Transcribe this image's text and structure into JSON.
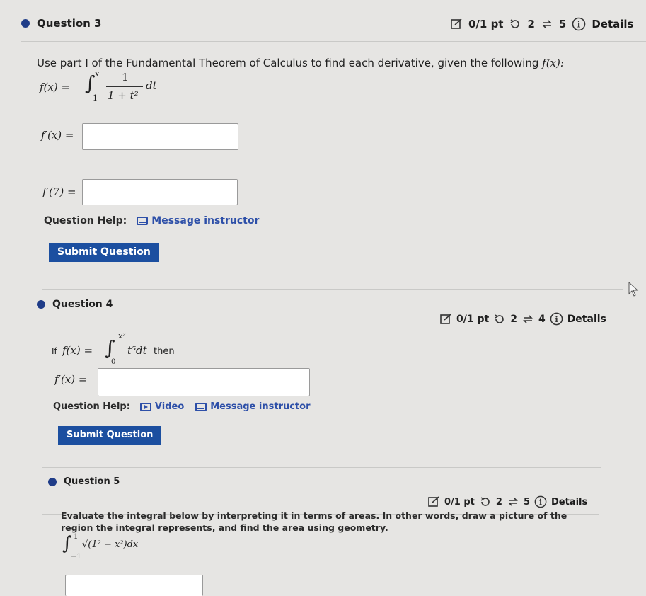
{
  "q3": {
    "title": "Question 3",
    "points": "0/1 pt",
    "tries": "2",
    "attempts": "5",
    "details": "Details",
    "prompt": "Use part I of the Fundamental Theorem of Calculus to find each derivative, given the following",
    "prompt_fx": "f(x):",
    "fx_label": "f(x) =",
    "integral_upper": "x",
    "integral_lower": "1",
    "integrand_num": "1",
    "integrand_den": "1 + t²",
    "integrand_dt": "dt",
    "ans1_label": "f′(x) =",
    "ans2_label": "f′(7) =",
    "help_label": "Question Help:",
    "help_message": "Message instructor",
    "submit": "Submit Question"
  },
  "q4": {
    "title": "Question 4",
    "points": "0/1 pt",
    "tries": "2",
    "attempts": "4",
    "details": "Details",
    "if_text": "If",
    "fx_label": "f(x) =",
    "integral_upper": "x²",
    "integral_lower": "0",
    "integrand": "t⁵dt",
    "then_text": "then",
    "ans_label": "f′(x) =",
    "help_label": "Question Help:",
    "help_video": "Video",
    "help_message": "Message instructor",
    "submit": "Submit Question"
  },
  "q5": {
    "title": "Question 5",
    "points": "0/1 pt",
    "tries": "2",
    "attempts": "5",
    "details": "Details",
    "prompt_line1": "Evaluate the integral below by interpreting it in terms of areas. In other words, draw a picture of the",
    "prompt_line2": "region the integral represents, and find the area using geometry.",
    "integral_upper": "1",
    "integral_lower": "−1",
    "integrand": "√(1² − x²)dx"
  },
  "colors": {
    "accent": "#1c4fa0",
    "link": "#2d4fa8",
    "bullet": "#1f3c88"
  }
}
